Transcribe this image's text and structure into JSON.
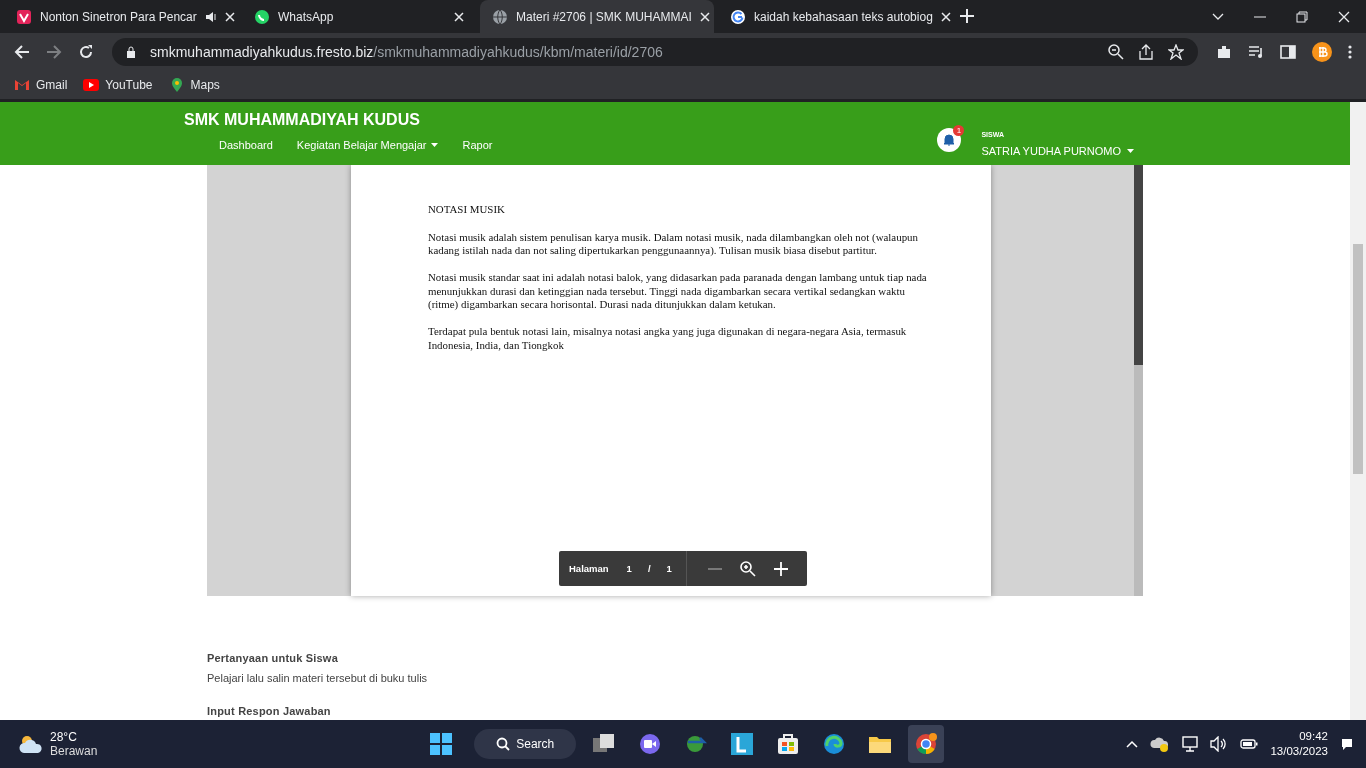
{
  "browser": {
    "tabs": [
      {
        "title": "Nonton Sinetron Para Pencar",
        "kind": "video",
        "audio": true,
        "selected": false
      },
      {
        "title": "WhatsApp",
        "kind": "chat",
        "audio": false,
        "selected": false
      },
      {
        "title": "Materi #2706 | SMK MUHAMMAI",
        "kind": "globe",
        "audio": false,
        "selected": true
      },
      {
        "title": "kaidah kebahasaan teks autobiog",
        "kind": "google",
        "audio": false,
        "selected": false
      }
    ],
    "address": {
      "host": "smkmuhammadiyahkudus.fresto.biz",
      "path": "/smkmuhammadiyahkudus/kbm/materi/id/2706"
    },
    "bookmarks": [
      {
        "label": "Gmail",
        "kind": "mail"
      },
      {
        "label": "YouTube",
        "kind": "play"
      },
      {
        "label": "Maps",
        "kind": "pin"
      }
    ]
  },
  "site": {
    "brand": "SMK MUHAMMADIYAH KUDUS",
    "nav": [
      {
        "label": "Dashboard",
        "dropdown": false
      },
      {
        "label": "Kegiatan Belajar Mengajar",
        "dropdown": true
      },
      {
        "label": "Rapor",
        "dropdown": false
      }
    ],
    "notifications": "1",
    "user": {
      "role": "SISWA",
      "name": "SATRIA YUDHA PURNOMO"
    }
  },
  "document": {
    "heading": "NOTASI MUSIK",
    "paragraphs": [
      "Notasi musik adalah sistem penulisan karya musik. Dalam notasi musik, nada dilambangkan oleh not (walaupun kadang istilah nada dan not saling dipertukarkan penggunaannya). Tulisan musik biasa disebut partitur.",
      "Notasi musik standar saat ini adalah notasi balok, yang didasarkan pada paranada dengan lambang untuk tiap nada menunjukkan durasi dan ketinggian nada tersebut. Tinggi nada digambarkan secara vertikal sedangkan waktu (ritme) digambarkan secara horisontal. Durasi nada ditunjukkan dalam ketukan.",
      "Terdapat pula bentuk notasi lain, misalnya notasi angka yang juga digunakan di negara-negara Asia, termasuk Indonesia, India, dan Tiongkok"
    ],
    "toolbar": {
      "label": "Halaman",
      "current": "1",
      "separator": "/",
      "total": "1"
    }
  },
  "question": {
    "heading": "Pertanyaan untuk Siswa",
    "text": "Pelajari lalu salin materi tersebut di buku tulis"
  },
  "response": {
    "heading": "Input Respon Jawaban"
  },
  "taskbar": {
    "weather": {
      "temperature": "28°C",
      "condition": "Berawan"
    },
    "search": "Search",
    "apps": [
      {
        "kind": "tasks",
        "active": false
      },
      {
        "kind": "chat",
        "active": false
      },
      {
        "kind": "download",
        "active": false
      },
      {
        "kind": "letter",
        "active": false
      },
      {
        "kind": "store",
        "active": false
      },
      {
        "kind": "edge",
        "active": false
      },
      {
        "kind": "folder",
        "active": false
      },
      {
        "kind": "chrome",
        "active": true
      }
    ],
    "time": "09:42",
    "date": "13/03/2023"
  }
}
